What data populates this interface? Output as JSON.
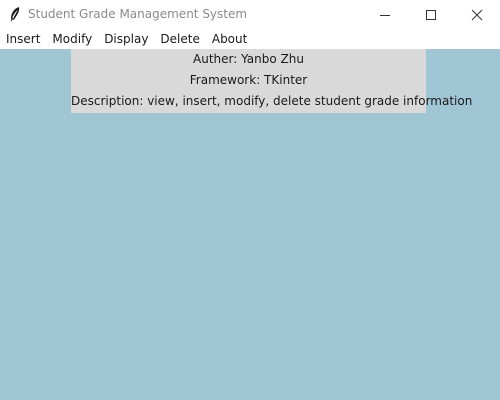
{
  "window": {
    "title": "Student Grade Management System",
    "icons": {
      "app": "feather-icon",
      "minimize": "minimize-icon",
      "maximize": "maximize-icon",
      "close": "close-icon"
    }
  },
  "menubar": {
    "items": [
      {
        "label": "Insert"
      },
      {
        "label": "Modify"
      },
      {
        "label": "Display"
      },
      {
        "label": "Delete"
      },
      {
        "label": "About"
      }
    ]
  },
  "info": {
    "author": "Auther: Yanbo Zhu",
    "framework": "Framework: TKinter",
    "description": "Description: view, insert, modify, delete student grade information"
  },
  "colors": {
    "titlebar_bg": "#ffffff",
    "client_bg": "#a0c6d6",
    "panel_bg": "#d9d9d9",
    "title_text": "#8a8a8a"
  }
}
